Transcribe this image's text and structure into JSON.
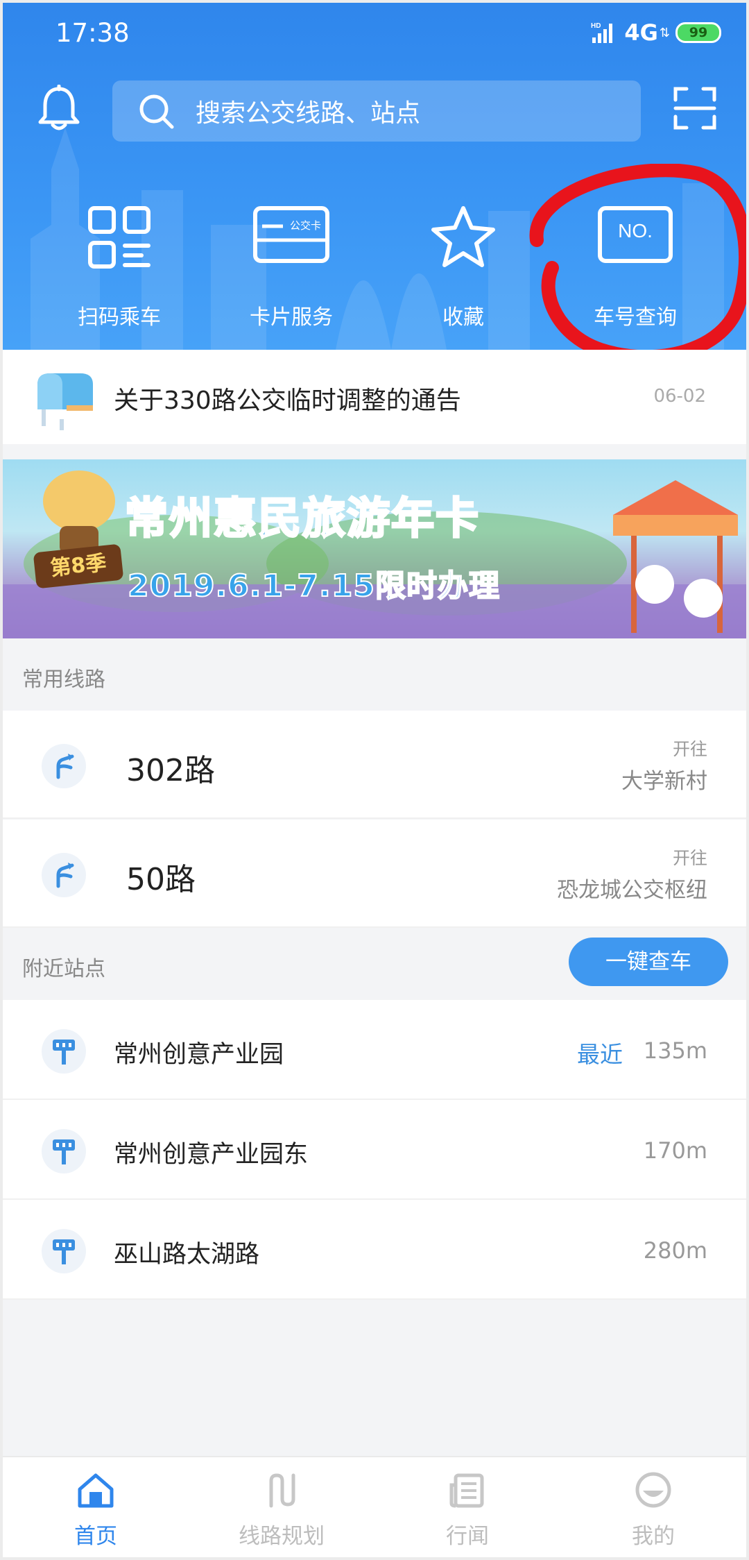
{
  "status_bar": {
    "time": "17:38",
    "network": "4G",
    "hd": "HD",
    "battery": "99"
  },
  "header": {
    "search_placeholder": "搜索公交线路、站点",
    "quick_actions": [
      {
        "label": "扫码乘车",
        "icon": "qr-grid-icon"
      },
      {
        "label": "卡片服务",
        "icon": "bus-card-icon",
        "card_text": "公交卡"
      },
      {
        "label": "收藏",
        "icon": "star-icon"
      },
      {
        "label": "车号查询",
        "icon": "vehicle-number-icon",
        "badge_text": "NO."
      }
    ]
  },
  "notice": {
    "text": "关于330路公交临时调整的通告",
    "date": "06-02"
  },
  "banner": {
    "season": "第8季",
    "title": "常州惠民旅游年卡",
    "subtitle": "2019.6.1-7.15限时办理"
  },
  "frequent_routes": {
    "heading": "常用线路",
    "items": [
      {
        "name": "302路",
        "direction_label": "开往",
        "destination": "大学新村"
      },
      {
        "name": "50路",
        "direction_label": "开往",
        "destination": "恐龙城公交枢纽"
      }
    ]
  },
  "nearby_stops": {
    "heading": "附近站点",
    "action": "一键查车",
    "items": [
      {
        "name": "常州创意产业园",
        "tag": "最近",
        "distance": "135m"
      },
      {
        "name": "常州创意产业园东",
        "tag": "",
        "distance": "170m"
      },
      {
        "name": "巫山路太湖路",
        "tag": "",
        "distance": "280m"
      }
    ]
  },
  "tabbar": {
    "tabs": [
      {
        "label": "首页",
        "icon": "home-icon",
        "active": true
      },
      {
        "label": "线路规划",
        "icon": "route-icon",
        "active": false
      },
      {
        "label": "行闻",
        "icon": "news-icon",
        "active": false
      },
      {
        "label": "我的",
        "icon": "profile-icon",
        "active": false
      }
    ]
  },
  "colors": {
    "primary": "#2f86ec",
    "accent": "#3f98f0",
    "annotation": "#e8141c"
  }
}
